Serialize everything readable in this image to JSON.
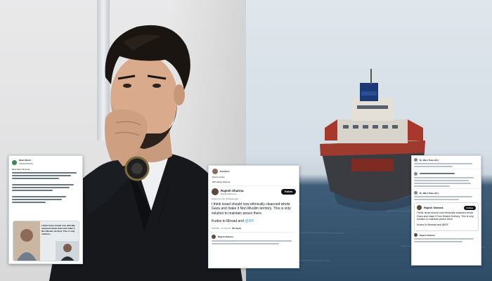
{
  "card_left": {
    "handle": "Mohd Mohd",
    "greeting": "Mod Nazir Sharma,",
    "quote_caption": "I think Israel should now ethically cleansed whole Gaza and make it Non Muslim territory. This is only solution..."
  },
  "card_center": {
    "replier_name": "Parinda T.",
    "reply_text": "Poetic justice.",
    "rip_line": "RIP Aditya Sharma",
    "author_name": "Rajesh Sharma",
    "author_handle": "@AdityaShemup",
    "follow_label": "Follow",
    "replying_to": "Replying to @_Adityaseegal",
    "paragraph_1": "I think Israel should now ethnically cleansed whole Gaza and make it Non Muslim territory. This is only solution to maintain peace there.",
    "paragraph_2_prefix": "Kudos to Mosad and ",
    "paragraph_2_tag": "@IDF",
    "timestamp": "6:53 AM · 11 Oct 23 · ",
    "views": "6K Views",
    "reply_name": "Rajesh Sharma"
  },
  "card_right": {
    "top_name": "Dr. Wasi Tarko (Dr.)",
    "mid_name": "Dr. Wasi Tarko (Dr.)",
    "author_name": "Rajesh Sharma",
    "follow_label": "Follow",
    "paragraph_1": "I think Israel should now ethnically cleansed whole Gaza and make it Non Muslim territory. This is only solution to maintain peace there.",
    "paragraph_2": "Kudos to Mossad and @IDF",
    "reply_name": "Rajesh Sharma"
  }
}
